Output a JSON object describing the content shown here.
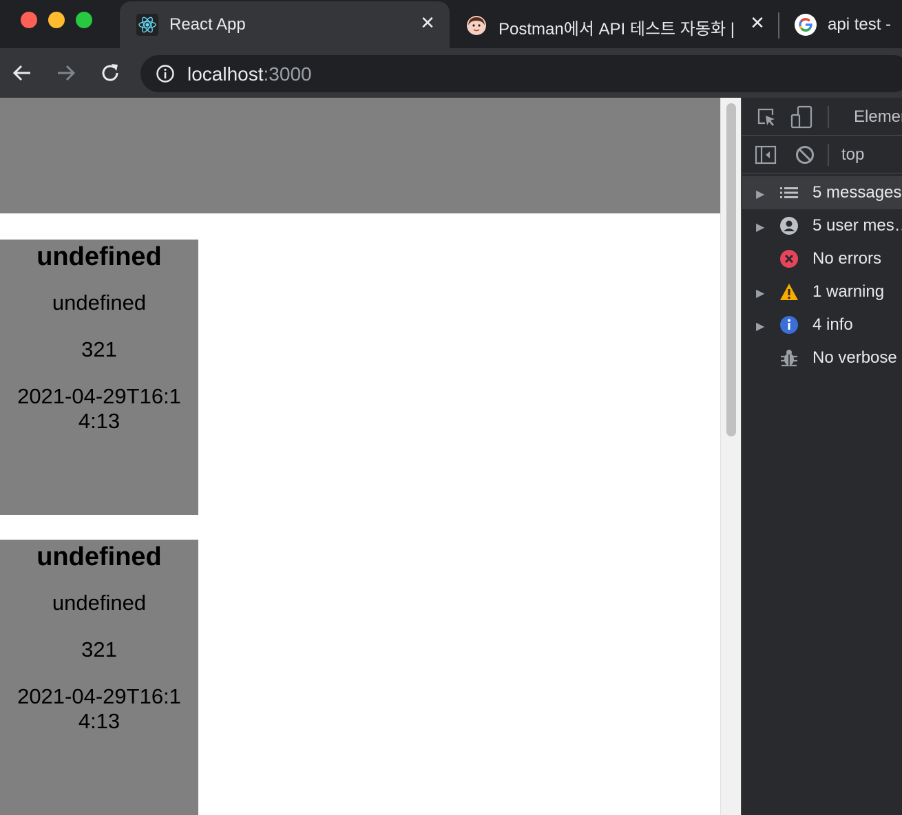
{
  "browser": {
    "tabs": [
      {
        "title": "React App",
        "active": true
      },
      {
        "title": "Postman에서 API 테스트 자동화 | H",
        "active": false
      },
      {
        "title": "api test -",
        "active": false
      }
    ],
    "url": {
      "host": "localhost",
      "port": ":3000"
    }
  },
  "page": {
    "cards": [
      {
        "title": "undefined",
        "subtitle": "undefined",
        "number": "321",
        "date": "2021-04-29T16:14:13"
      },
      {
        "title": "undefined",
        "subtitle": "undefined",
        "number": "321",
        "date": "2021-04-29T16:14:13"
      }
    ]
  },
  "devtools": {
    "tab_label": "Elemen",
    "context": "top",
    "sidebar": [
      {
        "label": "5 messages",
        "icon": "list-icon"
      },
      {
        "label": "5 user mes…",
        "icon": "user-icon"
      },
      {
        "label": "No errors",
        "icon": "error-icon"
      },
      {
        "label": "1 warning",
        "icon": "warning-icon"
      },
      {
        "label": "4 info",
        "icon": "info-icon"
      },
      {
        "label": "No verbose",
        "icon": "bug-icon"
      }
    ]
  },
  "colors": {
    "close": "#ff5f57",
    "minimize": "#febc2e",
    "zoom": "#28c840",
    "error": "#e8455a",
    "warning": "#f9ab00",
    "info": "#3a6fd8"
  }
}
